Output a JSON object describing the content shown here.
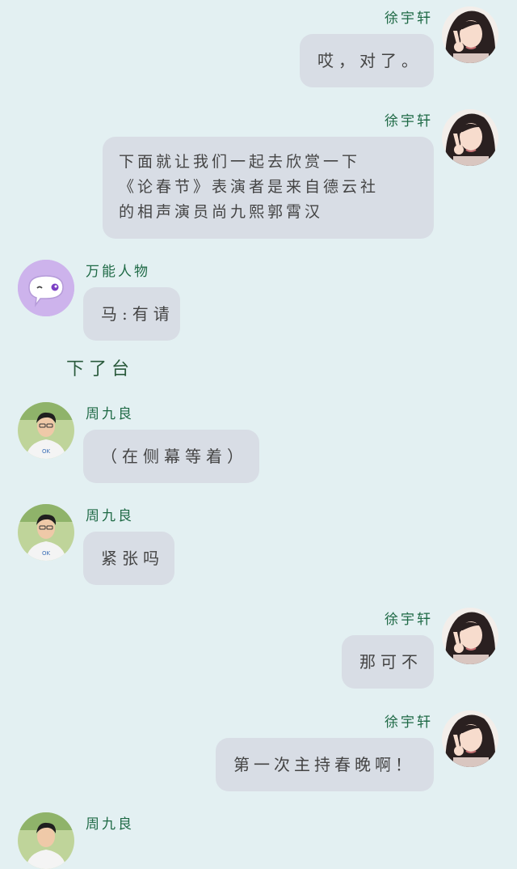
{
  "messages": [
    {
      "sender": "徐宇轩",
      "side": "right",
      "avatar": "female-avatar",
      "lines": [
        "哎，对了。"
      ]
    },
    {
      "sender": "徐宇轩",
      "side": "right",
      "avatar": "female-avatar",
      "lines": [
        "下面就让我们一起去欣赏一下",
        "《论春节》表演者是来自德云社",
        "的相声演员尚九熙郭霄汉"
      ]
    },
    {
      "sender": "万能人物",
      "side": "left",
      "avatar": "speech-bubble-avatar",
      "lines": [
        "马:有请"
      ]
    },
    {
      "sender": "周九良",
      "side": "left",
      "avatar": "male-avatar",
      "lines": [
        "（在侧幕等着）"
      ]
    },
    {
      "sender": "周九良",
      "side": "left",
      "avatar": "male-avatar",
      "lines": [
        "紧张吗"
      ]
    },
    {
      "sender": "徐宇轩",
      "side": "right",
      "avatar": "female-avatar",
      "lines": [
        "那可不"
      ]
    },
    {
      "sender": "徐宇轩",
      "side": "right",
      "avatar": "female-avatar",
      "lines": [
        "第一次主持春晚啊！"
      ]
    },
    {
      "sender": "周九良",
      "side": "left",
      "avatar": "male-avatar",
      "lines": []
    }
  ],
  "narration": "下了台",
  "colors": {
    "background": "#e3f0f2",
    "bubble": "#d8dde5",
    "sender_name": "#1f6a46",
    "speech_avatar_bg": "#cdb3ec"
  }
}
